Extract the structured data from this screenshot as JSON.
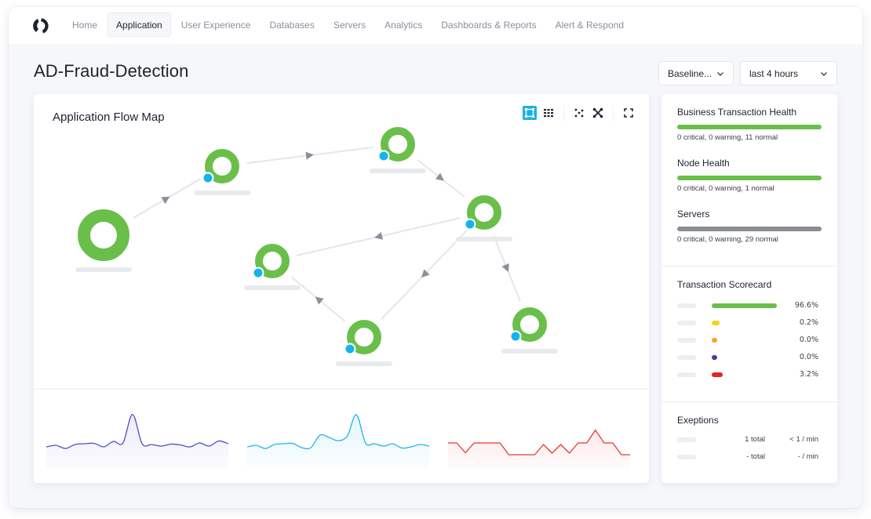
{
  "nav": {
    "logo": "app-logo",
    "items": [
      {
        "label": "Home",
        "active": false
      },
      {
        "label": "Application",
        "active": true
      },
      {
        "label": "User Experience",
        "active": false
      },
      {
        "label": "Databases",
        "active": false
      },
      {
        "label": "Servers",
        "active": false
      },
      {
        "label": "Analytics",
        "active": false
      },
      {
        "label": "Dashboards & Reports",
        "active": false
      },
      {
        "label": "Alert & Respond",
        "active": false
      }
    ]
  },
  "page": {
    "title": "AD-Fraud-Detection",
    "baseline_select": "Baseline...",
    "time_select": "last 4 hours"
  },
  "flow_map": {
    "title": "Application Flow Map",
    "toolbar": [
      "flow-map-icon",
      "grid-view-icon",
      "scatter-icon",
      "collapse-icon",
      "fullscreen-icon"
    ],
    "colors": {
      "node": "#6abf4b",
      "status_dot": "#12b5ea",
      "edge": "#e4e6ec",
      "arrow": "#8c9099",
      "label_placeholder": "#e9eaee"
    },
    "nodes": [
      {
        "id": "n1",
        "size": "large",
        "status_dot": false
      },
      {
        "id": "n2",
        "size": "medium",
        "status_dot": true
      },
      {
        "id": "n3",
        "size": "medium",
        "status_dot": true
      },
      {
        "id": "n4",
        "size": "medium",
        "status_dot": true
      },
      {
        "id": "n5",
        "size": "medium",
        "status_dot": true
      },
      {
        "id": "n6",
        "size": "medium",
        "status_dot": true
      },
      {
        "id": "n7",
        "size": "medium",
        "status_dot": true
      }
    ],
    "edges": [
      {
        "from": "n1",
        "to": "n2"
      },
      {
        "from": "n2",
        "to": "n3"
      },
      {
        "from": "n3",
        "to": "n4"
      },
      {
        "from": "n4",
        "to": "n5"
      },
      {
        "from": "n4",
        "to": "n6"
      },
      {
        "from": "n4",
        "to": "n7"
      },
      {
        "from": "n6",
        "to": "n5"
      }
    ]
  },
  "sparklines": [
    {
      "name": "sparkline-calls",
      "color": "#4f4fd0",
      "fill": "#ecebfa",
      "values": [
        3,
        3.4,
        2.6,
        3.6,
        3.8,
        3.9,
        3,
        4.4,
        4,
        11.3,
        3.8,
        3.6,
        3.2,
        3.7,
        3.5,
        3,
        4,
        3.2,
        4.5,
        3.8
      ]
    },
    {
      "name": "sparkline-response-time",
      "color": "#1fb5e6",
      "fill": "#e5f6fc",
      "values": [
        3,
        3.4,
        2.6,
        3.6,
        3.8,
        3.9,
        2.8,
        2.8,
        6,
        5.4,
        4.6,
        5.8,
        11.2,
        4,
        3.8,
        3.2,
        3.8,
        2.7,
        3,
        3.6,
        3.2
      ]
    },
    {
      "name": "sparkline-errors",
      "color": "#e33b32",
      "fill": "#fdeaea",
      "values": [
        4,
        4,
        1.5,
        4,
        4,
        4,
        4,
        1,
        1,
        1,
        1,
        3.6,
        1.4,
        3.6,
        1.4,
        4,
        4,
        7.3,
        4,
        4,
        1,
        1
      ]
    }
  ],
  "health": {
    "sections": [
      {
        "label": "Business Transaction Health",
        "status_text": "0 critical, 0 warning, 11 normal",
        "color": "#6abf4b"
      },
      {
        "label": "Node Health",
        "status_text": "0 critical, 0 warning, 1 normal",
        "color": "#6abf4b"
      },
      {
        "label": "Servers",
        "status_text": "0 critical, 0 warning, 29 normal",
        "color": "#8a8d93"
      }
    ]
  },
  "scorecard": {
    "label": "Transaction Scorecard",
    "rows": [
      {
        "value": "96.6%",
        "color": "#6abf4b",
        "fraction": 0.966
      },
      {
        "value": "0.2%",
        "color": "#f5d21c",
        "fraction": 0.002
      },
      {
        "value": "0.0%",
        "color": "#f5a623",
        "fraction": 0.0
      },
      {
        "value": "0.0%",
        "color": "#4a3aa8",
        "fraction": 0.0
      },
      {
        "value": "3.2%",
        "color": "#e12626",
        "fraction": 0.032
      }
    ]
  },
  "exceptions": {
    "label": "Exeptions",
    "rows": [
      {
        "total": "1 total",
        "rate": "< 1 / min"
      },
      {
        "total": "- total",
        "rate": "- / min"
      }
    ]
  }
}
